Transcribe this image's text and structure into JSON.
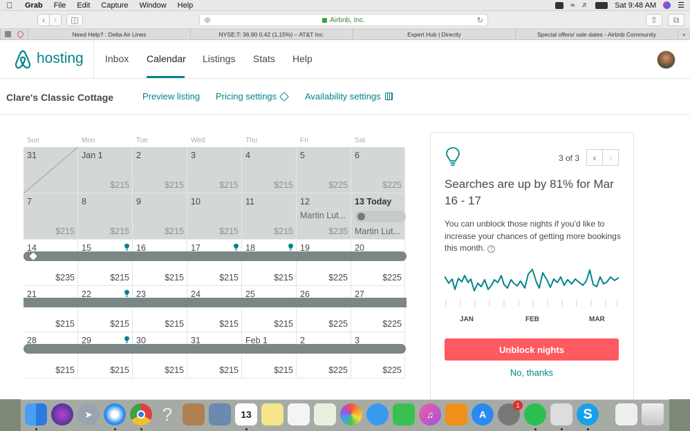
{
  "menubar": {
    "app": "Grab",
    "items": [
      "File",
      "Edit",
      "Capture",
      "Window",
      "Help"
    ],
    "clock": "Sat 9:48 AM"
  },
  "browser": {
    "url": "Airbnb, Inc.",
    "tabs": [
      "Need Help? : Delta Air Lines",
      "NYSE:T: 36.90 0.42 (1.15%) – AT&T Inc.",
      "Expert Hub | Directly",
      "Special offers/ sale dates - Airbnb Community"
    ]
  },
  "header": {
    "logo_text": "hosting",
    "nav": [
      "Inbox",
      "Calendar",
      "Listings",
      "Stats",
      "Help"
    ],
    "active": "Calendar"
  },
  "subheader": {
    "listing_name": "Clare's Classic Cottage",
    "preview": "Preview listing",
    "pricing": "Pricing settings",
    "availability": "Availability settings"
  },
  "calendar": {
    "days_of_week": [
      "Sun",
      "Mon",
      "Tue",
      "Wed",
      "Thu",
      "Fri",
      "Sat"
    ],
    "weeks": [
      [
        {
          "d": "31",
          "p": "",
          "past": true,
          "strike": true
        },
        {
          "d": "Jan 1",
          "p": "$215",
          "past": true
        },
        {
          "d": "2",
          "p": "$215",
          "past": true
        },
        {
          "d": "3",
          "p": "$215",
          "past": true
        },
        {
          "d": "4",
          "p": "$215",
          "past": true
        },
        {
          "d": "5",
          "p": "$225",
          "past": true
        },
        {
          "d": "6",
          "p": "$225",
          "past": true
        }
      ],
      [
        {
          "d": "7",
          "p": "$215",
          "past": true
        },
        {
          "d": "8",
          "p": "$215",
          "past": true
        },
        {
          "d": "9",
          "p": "$215",
          "past": true
        },
        {
          "d": "10",
          "p": "$215",
          "past": true
        },
        {
          "d": "11",
          "p": "$215",
          "past": true
        },
        {
          "d": "12",
          "p": "$235",
          "past": true,
          "event": "Martin Lut..."
        },
        {
          "d": "13 Today",
          "p": "",
          "past": true,
          "today": true,
          "event2": "Martin Lut..."
        }
      ],
      [
        {
          "d": "14",
          "p": "$235"
        },
        {
          "d": "15",
          "p": "$215",
          "bulb": true
        },
        {
          "d": "16",
          "p": "$215"
        },
        {
          "d": "17",
          "p": "$215",
          "bulb": true
        },
        {
          "d": "18",
          "p": "$215",
          "bulb": true
        },
        {
          "d": "19",
          "p": "$225"
        },
        {
          "d": "20",
          "p": "$225"
        }
      ],
      [
        {
          "d": "21",
          "p": "$215"
        },
        {
          "d": "22",
          "p": "$215",
          "bulb": true
        },
        {
          "d": "23",
          "p": "$215"
        },
        {
          "d": "24",
          "p": "$215"
        },
        {
          "d": "25",
          "p": "$215"
        },
        {
          "d": "26",
          "p": "$225"
        },
        {
          "d": "27",
          "p": "$225"
        }
      ],
      [
        {
          "d": "28",
          "p": "$215"
        },
        {
          "d": "29",
          "p": "$215",
          "bulb": true
        },
        {
          "d": "30",
          "p": "$215"
        },
        {
          "d": "31",
          "p": "$215"
        },
        {
          "d": "Feb 1",
          "p": "$215"
        },
        {
          "d": "2",
          "p": "$225"
        },
        {
          "d": "3",
          "p": "$225"
        }
      ]
    ]
  },
  "insight": {
    "pager": "3 of 3",
    "title": "Searches are up by 81% for Mar 16 - 17",
    "body": "You can unblock those nights if you'd like to increase your chances of getting more bookings this month.",
    "months": [
      "JAN",
      "FEB",
      "MAR"
    ],
    "unblock": "Unblock nights",
    "dismiss": "No, thanks"
  },
  "dock": {
    "calendar_day": "13",
    "badge": "1"
  },
  "colors": {
    "brand": "#00848a",
    "cta": "#ff5a5f",
    "blocked": "#7b8787",
    "past": "#d3d7d6"
  }
}
